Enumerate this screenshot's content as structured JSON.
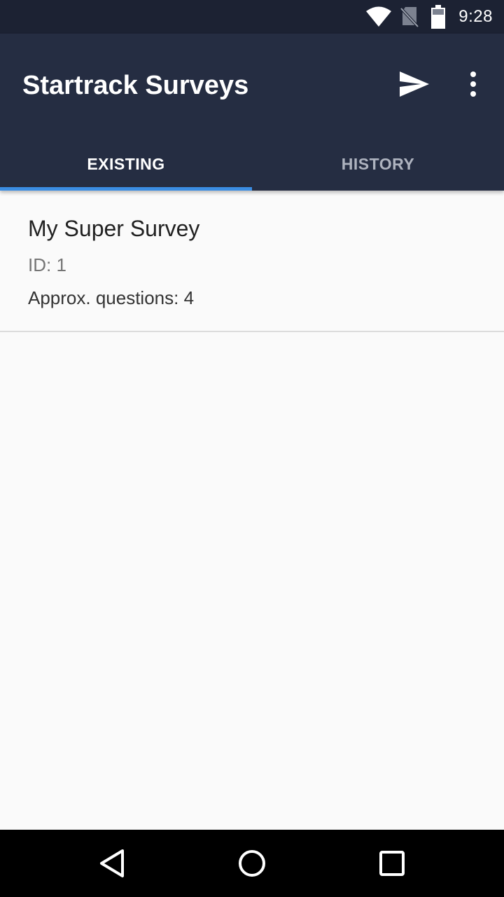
{
  "status_bar": {
    "time": "9:28",
    "icons": [
      "wifi-icon",
      "no-sim-icon",
      "battery-icon"
    ]
  },
  "app_bar": {
    "title": "Startrack Surveys",
    "actions": [
      "send-icon",
      "more-vert-icon"
    ],
    "background": "#252d42"
  },
  "tabs": [
    {
      "label": "EXISTING",
      "selected": true
    },
    {
      "label": "HISTORY",
      "selected": false
    }
  ],
  "tab_indicator_color": "#3b8de3",
  "surveys": [
    {
      "title": "My Super Survey",
      "id_text": "ID: 1",
      "questions_text": "Approx. questions: 4"
    }
  ],
  "nav_bar": {
    "icons": [
      "back-icon",
      "home-icon",
      "recents-icon"
    ]
  }
}
